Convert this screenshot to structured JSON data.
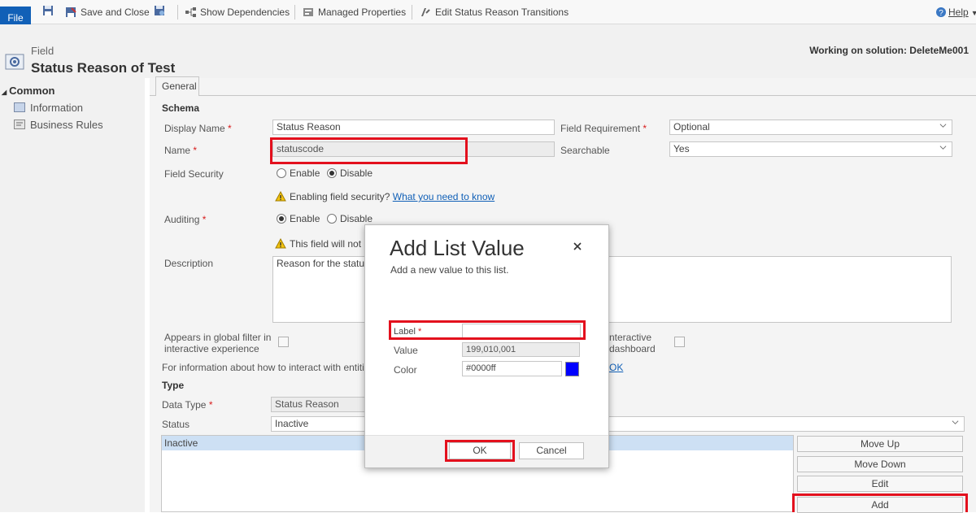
{
  "ribbon": {
    "file": "File",
    "save_and_close": "Save and Close",
    "show_dependencies": "Show Dependencies",
    "managed_properties": "Managed Properties",
    "edit_status_transitions": "Edit Status Reason Transitions",
    "help": "Help"
  },
  "header": {
    "entity_label": "Field",
    "title": "Status Reason of Test",
    "working_on": "Working on solution: DeleteMe001"
  },
  "nav": {
    "common": "Common",
    "items": [
      "Information",
      "Business Rules"
    ]
  },
  "tab": {
    "general": "General"
  },
  "schema": {
    "section": "Schema",
    "display_name_label": "Display Name",
    "display_name_value": "Status Reason",
    "field_requirement_label": "Field Requirement",
    "field_requirement_value": "Optional",
    "name_label": "Name",
    "name_value": "statuscode",
    "searchable_label": "Searchable",
    "searchable_value": "Yes",
    "field_security_label": "Field Security",
    "enable": "Enable",
    "disable": "Disable",
    "security_warning": "Enabling field security?",
    "security_link": "What you need to know",
    "auditing_label": "Auditing",
    "audit_warning": "This field will not be",
    "description_label": "Description",
    "description_value": "Reason for the status o",
    "global_filter_label_1": "Appears in global filter in",
    "global_filter_label_2": "interactive experience",
    "dashboard_label_1": "nteractive",
    "dashboard_label_2": "dashboard",
    "info_text": "For information about how to interact with entities a",
    "info_link": "OK"
  },
  "type": {
    "section": "Type",
    "data_type_label": "Data Type",
    "data_type_value": "Status Reason",
    "status_label": "Status",
    "status_value": "Inactive",
    "list_items": [
      "Inactive"
    ],
    "move_up": "Move Up",
    "move_down": "Move Down",
    "edit": "Edit",
    "add": "Add"
  },
  "dialog": {
    "title": "Add List Value",
    "subtitle": "Add a new value to this list.",
    "label_label": "Label",
    "label_value": "",
    "value_label": "Value",
    "value_value": "199,010,001",
    "color_label": "Color",
    "color_value": "#0000ff",
    "ok": "OK",
    "cancel": "Cancel"
  },
  "colors": {
    "accent": "#1160b7",
    "highlight": "#e3101d",
    "selected_row": "#cde0f4",
    "swatch": "#0000ff"
  }
}
